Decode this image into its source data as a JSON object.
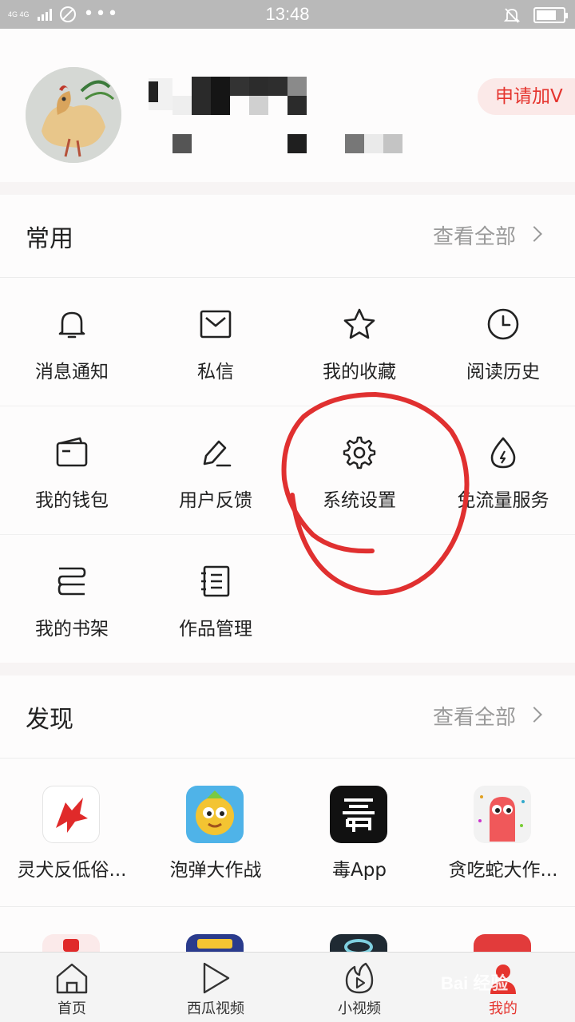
{
  "status_bar": {
    "network": "4G 4G",
    "more": "•••",
    "time": "13:48"
  },
  "profile": {
    "apply_v": "申请加V"
  },
  "common": {
    "title": "常用",
    "view_all": "查看全部",
    "items": [
      {
        "label": "消息通知",
        "icon": "bell-icon"
      },
      {
        "label": "私信",
        "icon": "mail-icon"
      },
      {
        "label": "我的收藏",
        "icon": "star-icon"
      },
      {
        "label": "阅读历史",
        "icon": "clock-icon"
      },
      {
        "label": "我的钱包",
        "icon": "wallet-icon"
      },
      {
        "label": "用户反馈",
        "icon": "pen-icon"
      },
      {
        "label": "系统设置",
        "icon": "gear-icon"
      },
      {
        "label": "免流量服务",
        "icon": "drop-icon"
      },
      {
        "label": "我的书架",
        "icon": "bookshelf-icon"
      },
      {
        "label": "作品管理",
        "icon": "notebook-icon"
      }
    ]
  },
  "discover": {
    "title": "发现",
    "view_all": "查看全部",
    "apps": [
      {
        "label": "灵犬反低俗...",
        "icon": "dog-app-icon"
      },
      {
        "label": "泡弹大作战",
        "icon": "bubble-game-icon"
      },
      {
        "label": "毒App",
        "icon": "du-app-icon"
      },
      {
        "label": "贪吃蛇大作...",
        "icon": "snake-game-icon"
      }
    ]
  },
  "bottom_nav": [
    {
      "label": "首页",
      "icon": "home-icon",
      "active": false
    },
    {
      "label": "西瓜视频",
      "icon": "play-icon",
      "active": false
    },
    {
      "label": "小视频",
      "icon": "short-video-icon",
      "active": false
    },
    {
      "label": "我的",
      "icon": "person-icon",
      "active": true
    }
  ],
  "watermark": "Bai 经验",
  "colors": {
    "accent": "#e5342e",
    "annotation": "#e03030",
    "status_bar": "#b9b9b9"
  }
}
